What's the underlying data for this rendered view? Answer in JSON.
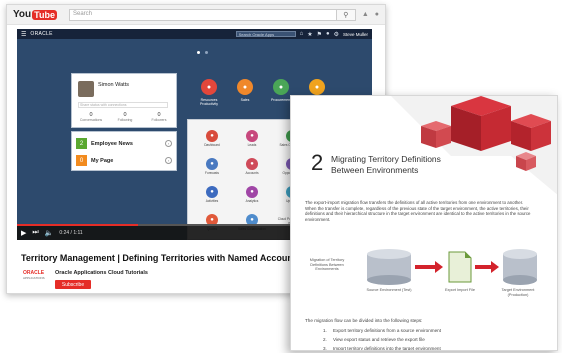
{
  "youtube": {
    "logo_you": "You",
    "logo_tube": "Tube",
    "search_placeholder": "Search",
    "video_title": "Territory Management | Defining Territories with Named Accounts",
    "channel_name": "Oracle Applications Cloud Tutorials",
    "channel_logo": "ORACLE",
    "channel_logo_sub": "APPLICATIONS",
    "subscribe_label": "Subscribe",
    "time": "0:24 / 1:11",
    "progress": 0.34
  },
  "oracle_app": {
    "brand": "ORACLE",
    "search_placeholder": "Search Oracle Apps",
    "user_name": "Steve Muller",
    "profile": {
      "name": "Simon Watts",
      "status_placeholder": "Share status with connections",
      "stats": [
        {
          "value": "0",
          "label": "Conversations"
        },
        {
          "value": "0",
          "label": "Following"
        },
        {
          "value": "0",
          "label": "Followers"
        }
      ]
    },
    "news": [
      {
        "badge": "2",
        "label": "Employee News",
        "color": "#5aa830"
      },
      {
        "badge": "0",
        "label": "My Page",
        "color": "#f28b1e"
      }
    ],
    "top_icons": [
      {
        "label": "Resources Productivity",
        "color": "#e3473b"
      },
      {
        "label": "Sales",
        "color": "#f0882b"
      },
      {
        "label": "Procurement",
        "color": "#4aa657"
      },
      {
        "label": "Collaborate",
        "color": "#f0a31e"
      }
    ],
    "tiles": [
      {
        "label": "Dashboard",
        "color": "#d84b3c"
      },
      {
        "label": "Leads",
        "color": "#c7487d"
      },
      {
        "label": "Sales Campaigns",
        "color": "#3f9b4d"
      },
      {
        "label": "Forecasts",
        "color": "#4979c0"
      },
      {
        "label": "Accounts",
        "color": "#cf4a59"
      },
      {
        "label": "Opportunities",
        "color": "#7b58b2"
      },
      {
        "label": "Activities",
        "color": "#3d6bbf"
      },
      {
        "label": "Analytics",
        "color": "#a046a6"
      },
      {
        "label": "Updates",
        "color": "#3d9fc0"
      },
      {
        "label": "Quotes",
        "color": "#e0593a"
      },
      {
        "label": "Sales Collaboration",
        "color": "#4f8ccc"
      },
      {
        "label": "Cloud Portal Search more",
        "color": ""
      }
    ]
  },
  "document": {
    "number": "2",
    "title": "Migrating Territory Definitions Between Environments",
    "body": "The export-import migration flow transfers the definitions of all active territories from one environment to another. When the transfer is complete, regardless of the previous state of the target environment, the active territories, their definitions and their hierarchical structure in the target environment are identical to the active territories in the source environment.",
    "diagram": {
      "left_label": "Migration of Territory Definitions Between Environments",
      "source_label": "Source Environment (Test)",
      "middle_label": "Export Import File",
      "target_label": "Target Environment (Production)"
    },
    "steps_intro": "The migration flow can be divided into the following steps:",
    "steps": [
      {
        "num": "1.",
        "text": "Export territory definitions from a source environment"
      },
      {
        "num": "2.",
        "text": "View export status and retrieve the export file"
      },
      {
        "num": "3.",
        "text": "Import territory definitions into the target environment"
      }
    ]
  }
}
